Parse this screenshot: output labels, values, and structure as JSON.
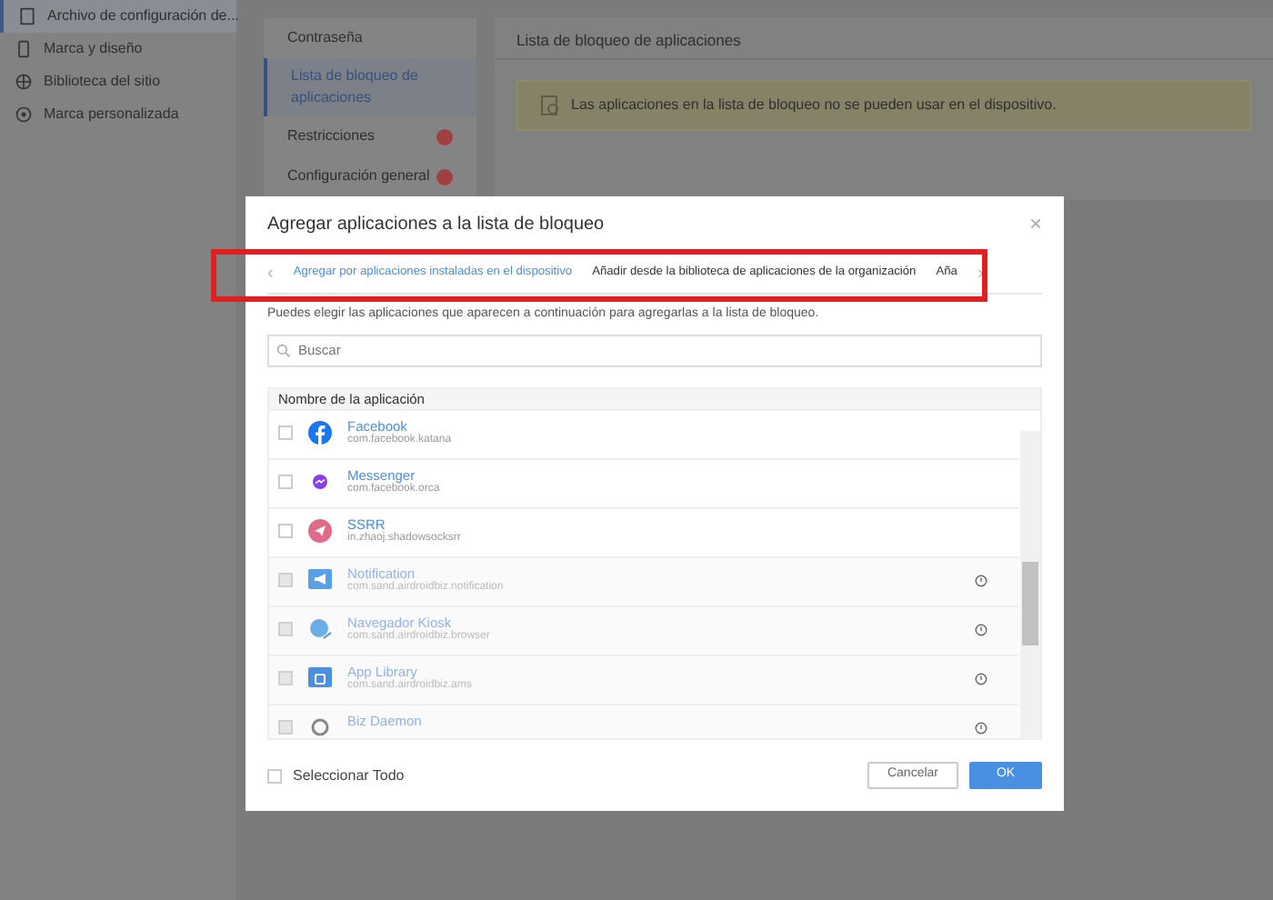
{
  "sidebar": {
    "items": [
      {
        "label": "Archivo de configuración de...",
        "selected": true
      },
      {
        "label": "Marca y diseño",
        "selected": false
      },
      {
        "label": "Biblioteca del sitio",
        "selected": false
      },
      {
        "label": "Marca personalizada",
        "selected": false
      }
    ]
  },
  "settings_nav": {
    "items": [
      {
        "label": "Contraseña",
        "selected": false,
        "warning": false
      },
      {
        "label": "Lista de bloqueo de aplicaciones",
        "selected": true,
        "warning": false
      },
      {
        "label": "Restricciones",
        "selected": false,
        "warning": true
      },
      {
        "label": "Configuración general",
        "selected": false,
        "warning": true
      }
    ]
  },
  "panel": {
    "title": "Lista de bloqueo de aplicaciones",
    "alert": "Las aplicaciones en la lista de bloqueo no se pueden usar en el dispositivo."
  },
  "dialog": {
    "title": "Agregar aplicaciones a la lista de bloqueo",
    "close": "×",
    "tab_prev": "‹",
    "tab_next": "›",
    "tabs": [
      {
        "label": "Agregar por aplicaciones instaladas en el dispositivo",
        "selected": true
      },
      {
        "label": "Añadir desde la biblioteca de aplicaciones de la organización",
        "selected": false
      },
      {
        "label": "Aña",
        "selected": false
      }
    ],
    "description": "Puedes elegir las aplicaciones que aparecen a continuación para agregarlas a la lista de bloqueo.",
    "search": {
      "placeholder": "Buscar"
    },
    "table": {
      "columns": [
        "Nombre de la aplicación"
      ],
      "rows": [
        {
          "name": "Facebook",
          "package": "com.facebook.katana",
          "disabled": false,
          "checked": false
        },
        {
          "name": "Messenger",
          "package": "com.facebook.orca",
          "disabled": false,
          "checked": false
        },
        {
          "name": "SSRR",
          "package": "in.zhaoj.shadowsocksrr",
          "disabled": false,
          "checked": false
        },
        {
          "name": "Notification",
          "package": "com.sand.airdroidbiz.notification",
          "disabled": true
        },
        {
          "name": "Navegador Kiosk",
          "package": "com.sand.airdroidbiz.browser",
          "disabled": true
        },
        {
          "name": "App Library",
          "package": "com.sand.airdroidbiz.ams",
          "disabled": true
        },
        {
          "name": "Biz Daemon",
          "disabled": true
        }
      ]
    },
    "select_all": {
      "label": "Seleccionar Todo",
      "checked": false
    },
    "buttons": [
      {
        "label": "Cancelar",
        "kind": "secondary"
      },
      {
        "label": "OK",
        "kind": "primary"
      }
    ]
  }
}
